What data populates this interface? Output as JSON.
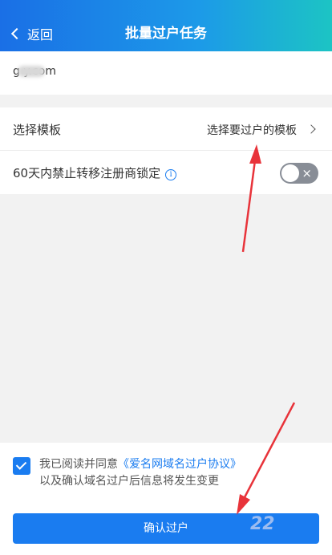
{
  "header": {
    "back_label": "返回",
    "title": "批量过户任务"
  },
  "domain": {
    "text": "g        y.com"
  },
  "template_row": {
    "label": "选择模板",
    "value": "选择要过户的模板"
  },
  "lock_row": {
    "label": "60天内禁止转移注册商锁定",
    "toggle_on": false,
    "toggle_icon": "×"
  },
  "agreement": {
    "checked": true,
    "prefix": "我已阅读并同意",
    "link": "《爱名网域名过户协议》",
    "line2": "以及确认域名过户后信息将发生变更"
  },
  "confirm_button": {
    "label": "确认过户"
  },
  "colors": {
    "accent": "#1a7cf0",
    "annotation": "#e8333a"
  }
}
